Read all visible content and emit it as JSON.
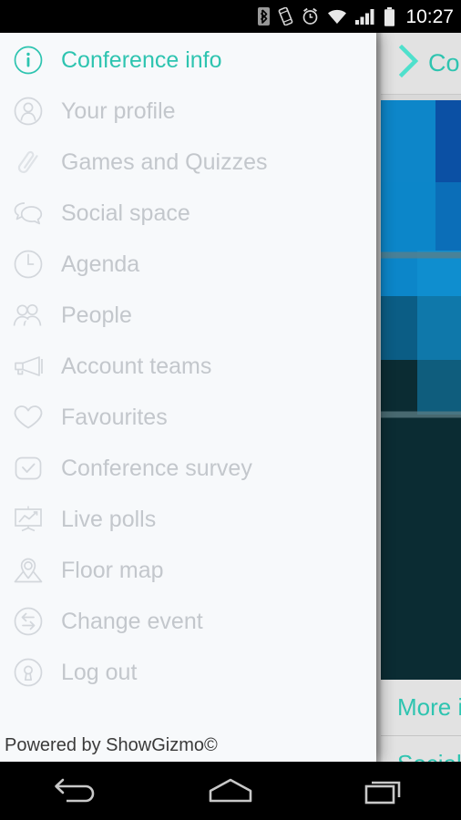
{
  "statusbar": {
    "time": "10:27",
    "icons": [
      "bluetooth-icon",
      "vibrate-icon",
      "alarm-icon",
      "wifi-icon",
      "signal-icon",
      "battery-icon"
    ]
  },
  "drawer": {
    "footer": "Powered by ShowGizmo©",
    "active_index": 0,
    "items": [
      {
        "label": "Conference info",
        "icon": "info-circle-icon"
      },
      {
        "label": "Your profile",
        "icon": "user-circle-icon"
      },
      {
        "label": "Games and Quizzes",
        "icon": "paperclip-icon"
      },
      {
        "label": "Social space",
        "icon": "chat-bubbles-icon"
      },
      {
        "label": "Agenda",
        "icon": "clock-icon"
      },
      {
        "label": "People",
        "icon": "people-icon"
      },
      {
        "label": "Account teams",
        "icon": "megaphone-icon"
      },
      {
        "label": "Favourites",
        "icon": "heart-icon"
      },
      {
        "label": "Conference survey",
        "icon": "check-square-icon"
      },
      {
        "label": "Live polls",
        "icon": "chart-board-icon"
      },
      {
        "label": "Floor map",
        "icon": "map-pin-icon"
      },
      {
        "label": "Change event",
        "icon": "exchange-circle-icon"
      },
      {
        "label": "Log out",
        "icon": "keyhole-circle-icon"
      }
    ]
  },
  "content": {
    "header_title": "Con",
    "header_icon": "chevron-right-icon",
    "list_items": [
      {
        "label": "More i"
      },
      {
        "label": "Social"
      }
    ]
  },
  "navbar": {
    "buttons": [
      {
        "name": "back-button",
        "icon": "back-arrow-icon"
      },
      {
        "name": "home-button",
        "icon": "home-icon"
      },
      {
        "name": "recents-button",
        "icon": "recent-apps-icon"
      }
    ]
  },
  "colors": {
    "accent_teal": "#2ec4b0",
    "drawer_bg": "#f7f9fb",
    "menu_gray": "#c3c7cc",
    "content_bg": "#e2e2e2",
    "hero_dark": "#0b2c33",
    "hero_blue": "#0d86c9"
  }
}
